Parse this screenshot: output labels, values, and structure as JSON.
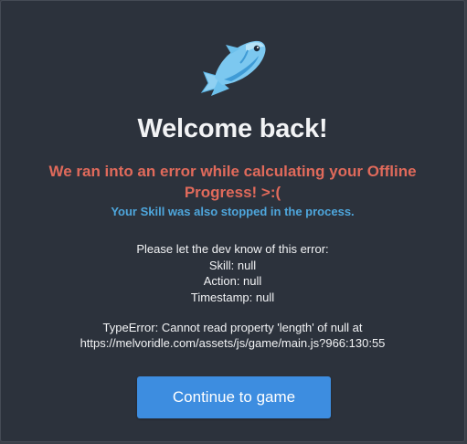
{
  "modal": {
    "title": "Welcome back!",
    "error_message": "We ran into an error while calculating your Offline Progress! >:(",
    "skill_stopped": "Your Skill was also stopped in the process.",
    "details": {
      "intro": "Please let the dev know of this error:",
      "skill": "Skill: null",
      "action": "Action: null",
      "timestamp": "Timestamp: null"
    },
    "type_error": {
      "line1": "TypeError: Cannot read property 'length' of null at",
      "line2": "https://melvoridle.com/assets/js/game/main.js?966:130:55"
    },
    "continue_label": "Continue to game",
    "icon": "fish-icon"
  },
  "colors": {
    "modal_bg": "#2c323c",
    "title": "#f2f3f5",
    "error": "#e06a5b",
    "info": "#4ea6dc",
    "button": "#3d8de0"
  }
}
